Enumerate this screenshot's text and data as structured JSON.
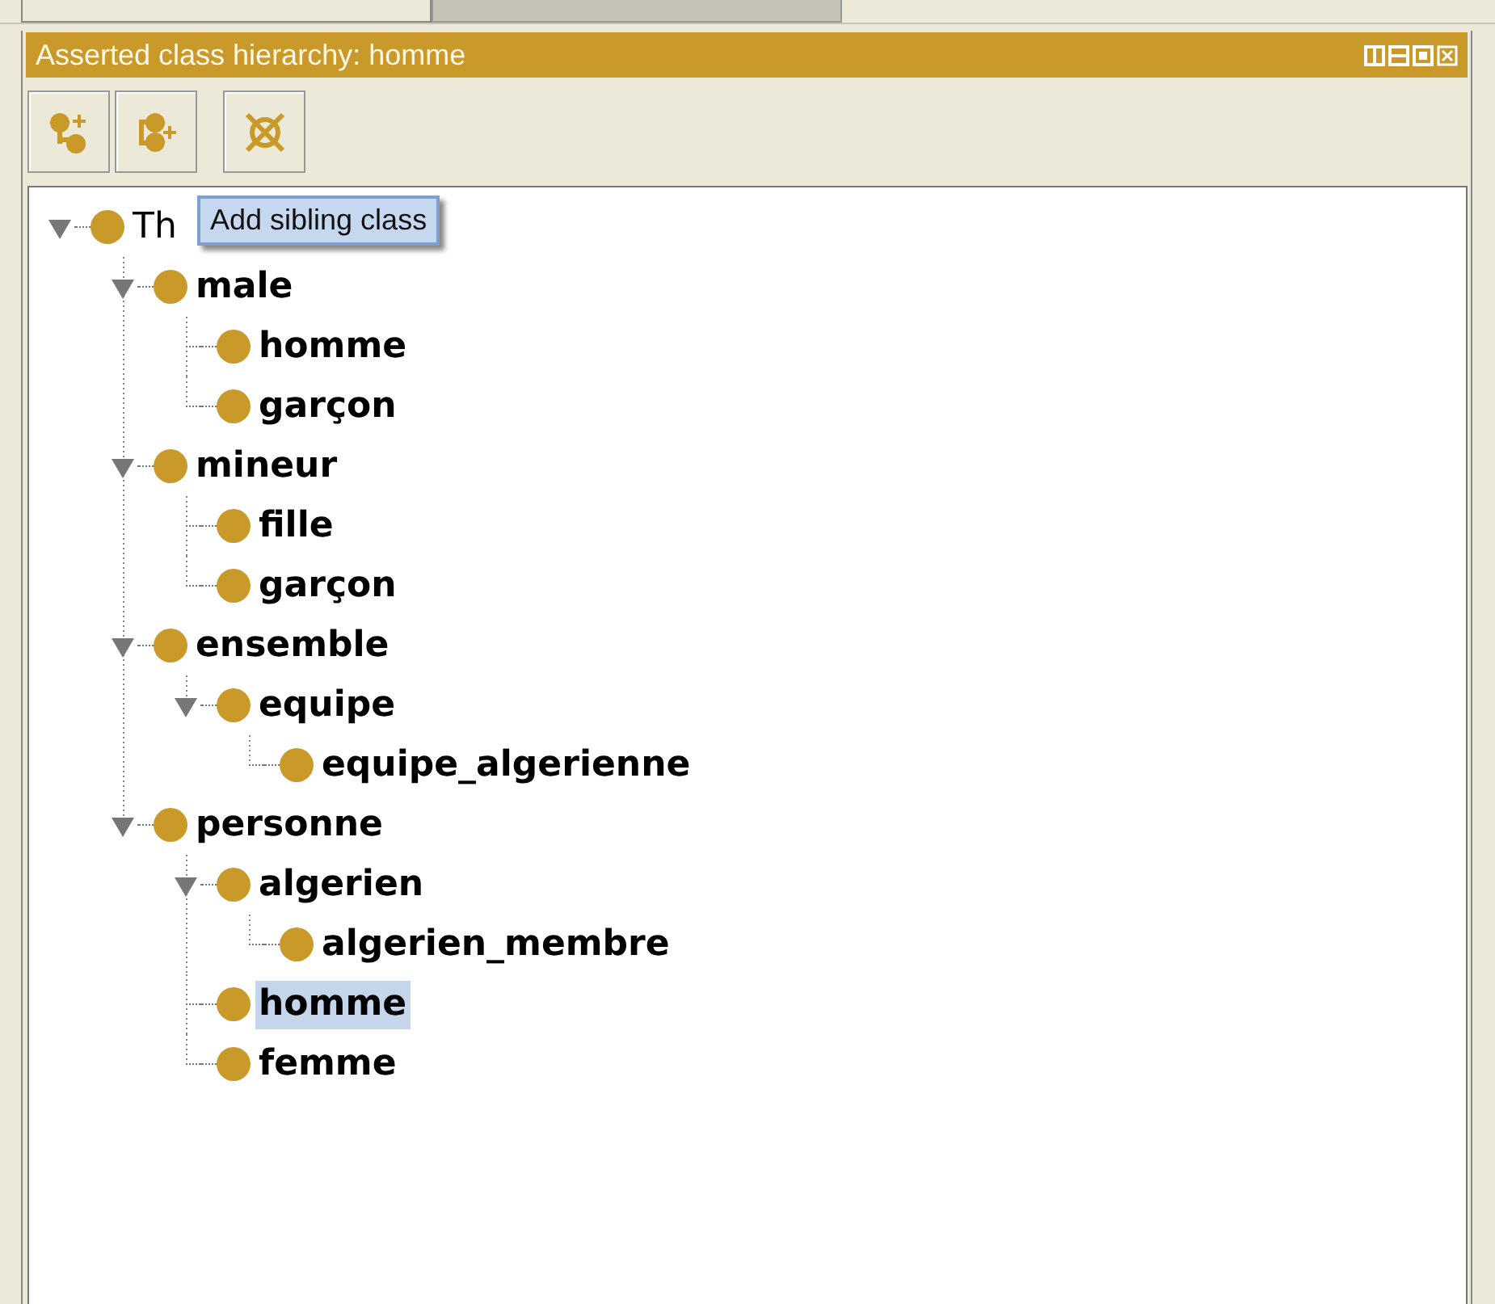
{
  "top_tabs": [
    {
      "selected": true
    },
    {
      "selected": false
    }
  ],
  "panel": {
    "title": "Asserted class hierarchy: homme"
  },
  "toolbar": [
    {
      "kind": "add-subclass"
    },
    {
      "kind": "add-sibling"
    },
    {
      "kind": "delete"
    }
  ],
  "tooltip": "Add sibling class",
  "class_tree": [
    {
      "label": "Th",
      "bold": false,
      "selected": false,
      "expanded": true,
      "children": [
        {
          "label": "male",
          "bold": true,
          "selected": false,
          "expanded": true,
          "children": [
            {
              "label": "homme",
              "bold": true,
              "selected": false
            },
            {
              "label": "garçon",
              "bold": true,
              "selected": false
            }
          ]
        },
        {
          "label": "mineur",
          "bold": true,
          "selected": false,
          "expanded": true,
          "children": [
            {
              "label": "fille",
              "bold": true,
              "selected": false
            },
            {
              "label": "garçon",
              "bold": true,
              "selected": false
            }
          ]
        },
        {
          "label": "ensemble",
          "bold": true,
          "selected": false,
          "expanded": true,
          "children": [
            {
              "label": "equipe",
              "bold": true,
              "selected": false,
              "expanded": true,
              "children": [
                {
                  "label": "equipe_algerienne",
                  "bold": true,
                  "selected": false
                }
              ]
            }
          ]
        },
        {
          "label": "personne",
          "bold": true,
          "selected": false,
          "expanded": true,
          "children": [
            {
              "label": "algerien",
              "bold": true,
              "selected": false,
              "expanded": true,
              "children": [
                {
                  "label": "algerien_membre",
                  "bold": true,
                  "selected": false
                }
              ]
            },
            {
              "label": "homme",
              "bold": true,
              "selected": true
            },
            {
              "label": "femme",
              "bold": true,
              "selected": false
            }
          ]
        }
      ]
    }
  ]
}
